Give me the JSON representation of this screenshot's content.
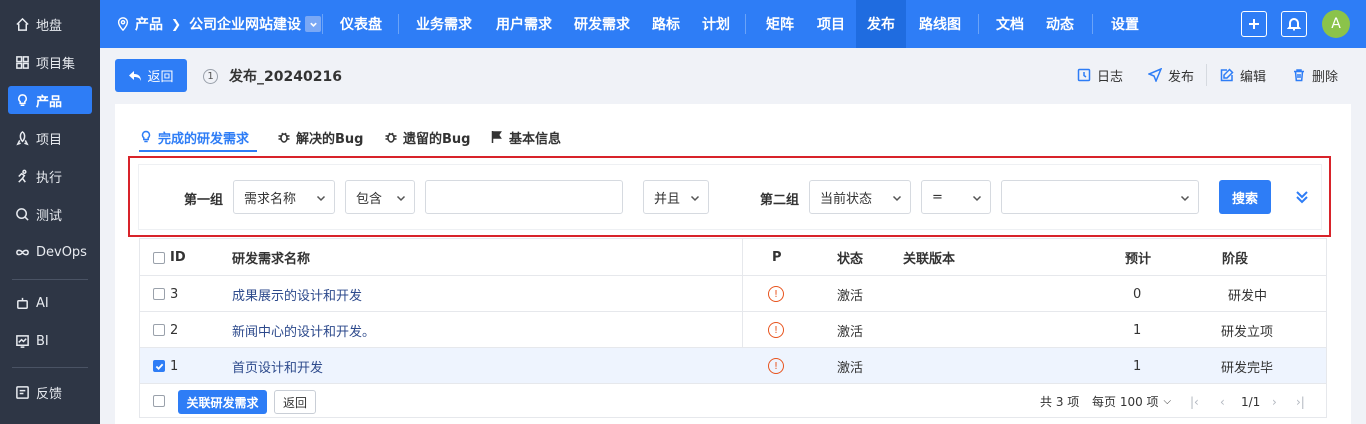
{
  "sidebar": {
    "items": [
      {
        "label": "地盘",
        "icon": "home-icon"
      },
      {
        "label": "项目集",
        "icon": "grid-icon"
      },
      {
        "label": "产品",
        "icon": "bulb-icon",
        "active": true
      },
      {
        "label": "项目",
        "icon": "rocket-icon"
      },
      {
        "label": "执行",
        "icon": "run-icon"
      },
      {
        "label": "测试",
        "icon": "search-test-icon"
      },
      {
        "label": "DevOps",
        "icon": "infinity-icon"
      },
      {
        "label": "AI",
        "icon": "robot-icon"
      },
      {
        "label": "BI",
        "icon": "chart-icon"
      },
      {
        "label": "反馈",
        "icon": "feedback-icon"
      }
    ]
  },
  "header": {
    "product_label": "产品",
    "project_name": "公司企业网站建设",
    "nav": [
      "仪表盘",
      "业务需求",
      "用户需求",
      "研发需求",
      "路标",
      "计划",
      "矩阵",
      "项目",
      "发布",
      "路线图",
      "文档",
      "动态",
      "设置"
    ],
    "active_nav": "发布",
    "avatar_letter": "A"
  },
  "toolbar": {
    "back_label": "返回",
    "release_id": "1",
    "release_name": "发布_20240216",
    "actions": {
      "log": "日志",
      "publish": "发布",
      "edit": "编辑",
      "delete": "删除"
    }
  },
  "tabs": [
    {
      "label": "完成的研发需求",
      "active": true
    },
    {
      "label": "解决的Bug"
    },
    {
      "label": "遗留的Bug"
    },
    {
      "label": "基本信息"
    }
  ],
  "search": {
    "group1_label": "第一组",
    "group1_field": "需求名称",
    "group1_op": "包含",
    "group1_value": "",
    "logic": "并且",
    "group2_label": "第二组",
    "group2_field": "当前状态",
    "group2_op": "=",
    "group2_value": "",
    "search_button": "搜索"
  },
  "table": {
    "headers": {
      "id": "ID",
      "name": "研发需求名称",
      "pri": "P",
      "status": "状态",
      "version": "关联版本",
      "estimate": "预计",
      "stage": "阶段"
    },
    "rows": [
      {
        "id": "3",
        "name": "成果展示的设计和开发",
        "pri": "!",
        "status": "激活",
        "version": "",
        "estimate": "0",
        "stage": "研发中",
        "checked": false
      },
      {
        "id": "2",
        "name": "新闻中心的设计和开发。",
        "pri": "!",
        "status": "激活",
        "version": "",
        "estimate": "1",
        "stage": "研发立项",
        "checked": false
      },
      {
        "id": "1",
        "name": "首页设计和开发",
        "pri": "!",
        "status": "激活",
        "version": "",
        "estimate": "1",
        "stage": "研发完毕",
        "checked": true
      }
    ],
    "footer": {
      "link_button": "关联研发需求",
      "back_button": "返回",
      "total": "共 3 项",
      "per_page": "每页 100 项",
      "page": "1/1"
    }
  },
  "colors": {
    "primary": "#2e7df6",
    "sidebar": "#2e3645",
    "highlight": "#d8232a",
    "priority": "#e8541e"
  }
}
